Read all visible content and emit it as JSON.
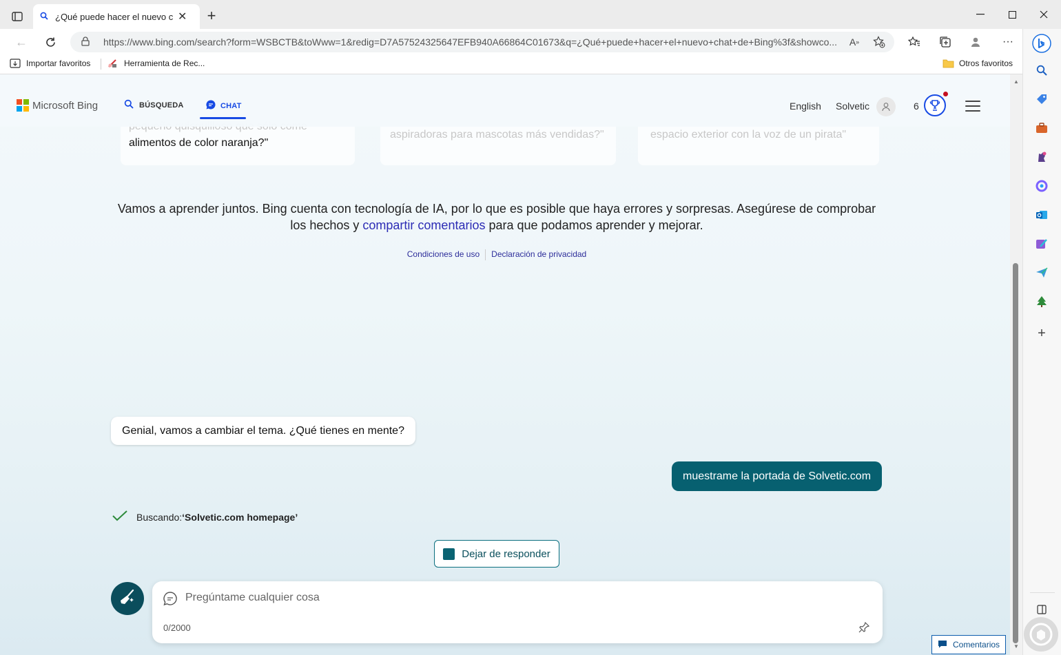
{
  "browser": {
    "tab_title": "¿Qué puede hacer el nuevo chat",
    "tab_close": "✕",
    "new_tab": "+",
    "url": "https://www.bing.com/search?form=WSBCTB&toWww=1&redig=D7A57524325647EFB940A66864C01673&q=¿Qué+puede+hacer+el+nuevo+chat+de+Bing%3f&showco...",
    "favorites": [
      "Importar favoritos",
      "Herramienta de Rec...",
      "Otros favoritos"
    ]
  },
  "bing": {
    "logo_text": "Microsoft Bing",
    "nav_search": "BÚSQUEDA",
    "nav_chat": "CHAT",
    "language": "English",
    "user": "Solvetic",
    "rewards_count": "6"
  },
  "suggestions": [
    {
      "faded": "pequeño quisquilloso que sólo come",
      "main": "alimentos de color naranja?\""
    },
    {
      "faded": "aspiradoras para mascotas más vendidas?\""
    },
    {
      "faded": "espacio exterior con la voz de un pirata\""
    }
  ],
  "disclaimer": {
    "part1": "Vamos a aprender juntos. Bing cuenta con tecnología de IA, por lo que es posible que haya errores y sorpresas. Asegúrese de comprobar los hechos y ",
    "link": "compartir comentarios",
    "part2": " para que podamos aprender y mejorar."
  },
  "legal": {
    "terms": "Condiciones de uso",
    "privacy": "Declaración de privacidad"
  },
  "chat": {
    "bot_message": "Genial, vamos a cambiar el tema. ¿Qué tienes en mente?",
    "user_message": "muestrame la portada de Solvetic.com",
    "searching_label": "Buscando: ",
    "searching_query": "‘Solvetic.com homepage’",
    "stop_label": "Dejar de responder",
    "input_placeholder": "Pregúntame cualquier cosa",
    "char_count": "0/2000"
  },
  "feedback_label": "Comentarios",
  "colors": {
    "accent": "#174ae4",
    "user_bubble": "#076070",
    "newtopic": "#0b4d5c"
  }
}
